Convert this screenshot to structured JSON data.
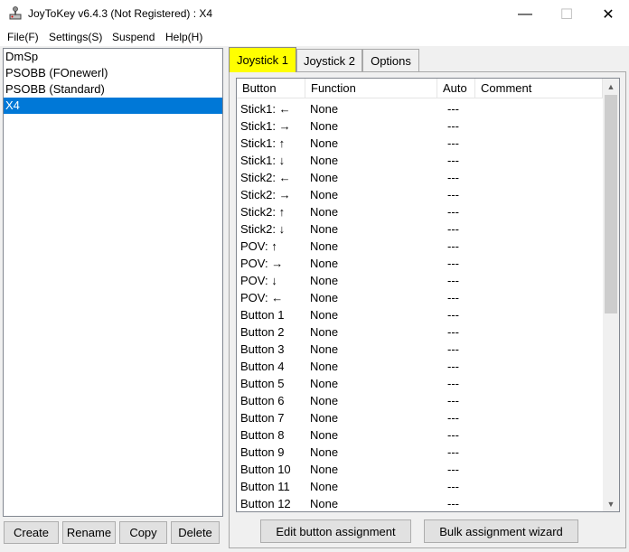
{
  "window": {
    "title": "JoyToKey v6.4.3 (Not Registered) : X4",
    "minimize_glyph": "—",
    "maximize_glyph": "☐",
    "close_glyph": "✕"
  },
  "menu": {
    "file": "File(F)",
    "settings": "Settings(S)",
    "suspend": "Suspend",
    "help": "Help(H)"
  },
  "profiles": [
    {
      "label": "DmSp"
    },
    {
      "label": "PSOBB (FOnewerl)"
    },
    {
      "label": "PSOBB (Standard)"
    },
    {
      "label": "X4",
      "selected": true
    }
  ],
  "profile_buttons": {
    "create": "Create",
    "rename": "Rename",
    "copy": "Copy",
    "delete": "Delete"
  },
  "tabs": {
    "joystick1": "Joystick 1",
    "joystick2": "Joystick 2",
    "options": "Options",
    "active_color": "#ffff00"
  },
  "table": {
    "headers": {
      "button": "Button",
      "function": "Function",
      "auto": "Auto",
      "comment": "Comment"
    },
    "rows": [
      {
        "button": "Stick1: ←",
        "function": "None",
        "auto": "---",
        "comment": ""
      },
      {
        "button": "Stick1: →",
        "function": "None",
        "auto": "---",
        "comment": ""
      },
      {
        "button": "Stick1: ↑",
        "function": "None",
        "auto": "---",
        "comment": ""
      },
      {
        "button": "Stick1: ↓",
        "function": "None",
        "auto": "---",
        "comment": ""
      },
      {
        "button": "Stick2: ←",
        "function": "None",
        "auto": "---",
        "comment": ""
      },
      {
        "button": "Stick2: →",
        "function": "None",
        "auto": "---",
        "comment": ""
      },
      {
        "button": "Stick2: ↑",
        "function": "None",
        "auto": "---",
        "comment": ""
      },
      {
        "button": "Stick2: ↓",
        "function": "None",
        "auto": "---",
        "comment": ""
      },
      {
        "button": "POV: ↑",
        "function": "None",
        "auto": "---",
        "comment": ""
      },
      {
        "button": "POV: →",
        "function": "None",
        "auto": "---",
        "comment": ""
      },
      {
        "button": "POV: ↓",
        "function": "None",
        "auto": "---",
        "comment": ""
      },
      {
        "button": "POV: ←",
        "function": "None",
        "auto": "---",
        "comment": ""
      },
      {
        "button": "Button 1",
        "function": "None",
        "auto": "---",
        "comment": ""
      },
      {
        "button": "Button 2",
        "function": "None",
        "auto": "---",
        "comment": ""
      },
      {
        "button": "Button 3",
        "function": "None",
        "auto": "---",
        "comment": ""
      },
      {
        "button": "Button 4",
        "function": "None",
        "auto": "---",
        "comment": ""
      },
      {
        "button": "Button 5",
        "function": "None",
        "auto": "---",
        "comment": ""
      },
      {
        "button": "Button 6",
        "function": "None",
        "auto": "---",
        "comment": ""
      },
      {
        "button": "Button 7",
        "function": "None",
        "auto": "---",
        "comment": ""
      },
      {
        "button": "Button 8",
        "function": "None",
        "auto": "---",
        "comment": ""
      },
      {
        "button": "Button 9",
        "function": "None",
        "auto": "---",
        "comment": ""
      },
      {
        "button": "Button 10",
        "function": "None",
        "auto": "---",
        "comment": ""
      },
      {
        "button": "Button 11",
        "function": "None",
        "auto": "---",
        "comment": ""
      },
      {
        "button": "Button 12",
        "function": "None",
        "auto": "---",
        "comment": ""
      }
    ]
  },
  "actions": {
    "edit_assignment": "Edit button assignment",
    "bulk_wizard": "Bulk assignment wizard"
  },
  "colors": {
    "selection": "#0078d7",
    "active_tab": "#ffff00"
  }
}
